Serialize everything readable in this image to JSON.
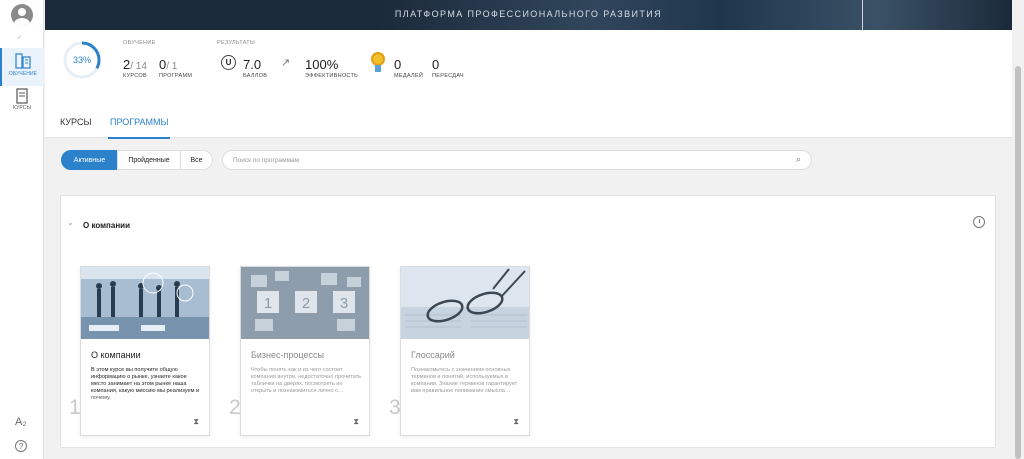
{
  "sidebar": {
    "items": [
      {
        "label": "ОБУЧЕНИЕ",
        "icon": "learning-icon",
        "active": true
      },
      {
        "label": "КУРСЫ",
        "icon": "courses-icon",
        "active": false
      }
    ]
  },
  "banner": {
    "title": "ПЛАТФОРМА ПРОФЕССИОНАЛЬНОГО РАЗВИТИЯ"
  },
  "stats": {
    "progress": "33%",
    "progress_fraction": 0.33,
    "learning_caption": "ОБУЧЕНИЕ",
    "results_caption": "РЕЗУЛЬТАТЫ",
    "courses_done": "2",
    "courses_total": "/ 14",
    "courses_label": "КУРСОВ",
    "programs_done": "0",
    "programs_total": "/ 1",
    "programs_label": "ПРОГРАММ",
    "score": "7.0",
    "score_label": "БАЛЛОВ",
    "score_icon_letter": "U",
    "efficiency": "100%",
    "efficiency_label": "ЭФФЕКТИВНОСТЬ",
    "medals": "0",
    "medals_label": "МЕДАЛЕЙ",
    "retakes": "0",
    "retakes_label": "ПЕРЕСДАЧ"
  },
  "tabs": [
    {
      "label": "КУРСЫ",
      "active": false
    },
    {
      "label": "ПРОГРАММЫ",
      "active": true
    }
  ],
  "filters": [
    {
      "label": "Активные",
      "active": true
    },
    {
      "label": "Пройденные",
      "active": false
    },
    {
      "label": "Все",
      "active": false
    }
  ],
  "search": {
    "placeholder": "Поиск по программам"
  },
  "group": {
    "title": "О компании",
    "cards": [
      {
        "number": "1",
        "title": "О компании",
        "description": "В этом курсе вы получите общую информацию о рынке, узнаете какое место занимает на этом рынке наша компания, какую миссию мы реализуем и почему.",
        "locked": false
      },
      {
        "number": "2",
        "title": "Бизнес-процессы",
        "description": "Чтобы понять как и из чего состоит компания внутри, недостаточно прочитать таблички на дверях, посмотреть их открыть и познакомиться лично с…",
        "locked": true
      },
      {
        "number": "3",
        "title": "Глоссарий",
        "description": "Познакомьтесь с значением основных терминов и понятий, используемых в компании. Знание терминов гарантирует вам правильное понимание смысла…",
        "locked": true
      }
    ]
  },
  "colors": {
    "accent": "#2b82cb",
    "banner": "#1b2a3a"
  }
}
